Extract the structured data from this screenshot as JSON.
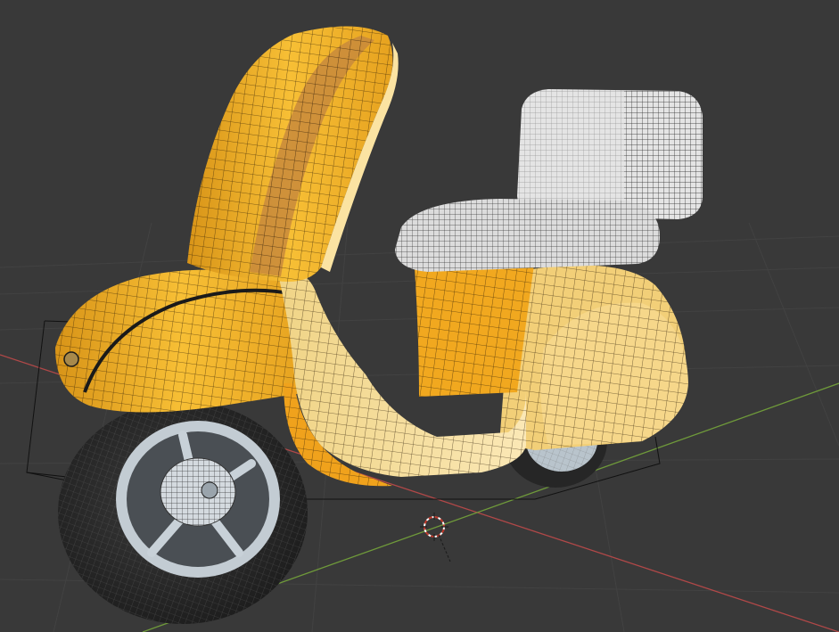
{
  "viewport": {
    "editor": "3D Viewport",
    "object": "scooter",
    "shading": "solid-with-wireframe-overlay"
  },
  "colors": {
    "background": "#393939",
    "grid_line": "#424242",
    "x_axis": "#b04848",
    "y_axis": "#6f9a3a",
    "body_yellow": "#f4b52a",
    "body_light": "#fbe3a2",
    "body_shadow": "#c98610",
    "wire": "#1a1a1a",
    "seat_white": "#d9d9d9",
    "tire": "#2a2a2a",
    "rim": "#b9c4cc"
  },
  "icons": {
    "cursor": "3d-cursor-icon"
  }
}
